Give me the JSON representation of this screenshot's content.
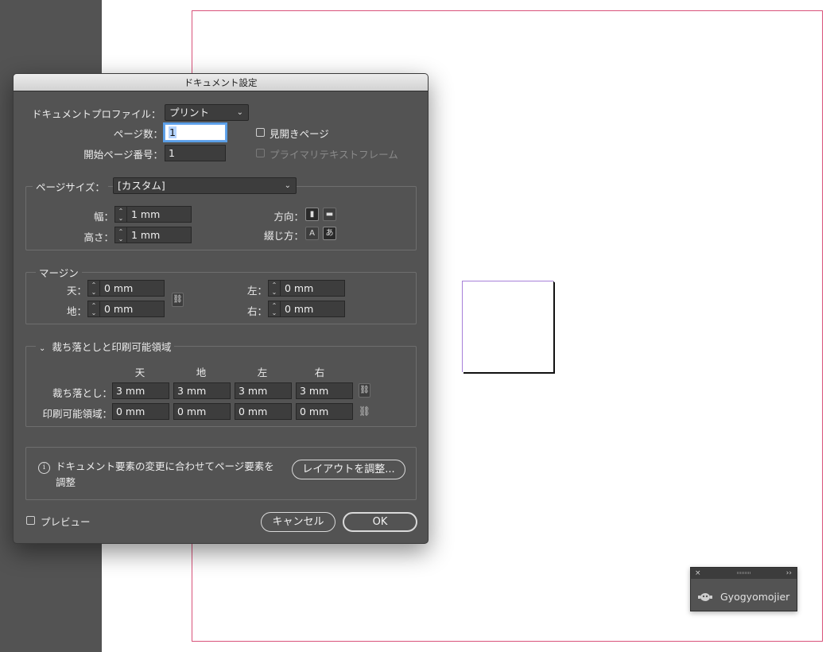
{
  "dialog": {
    "title": "ドキュメント設定",
    "profile_label": "ドキュメントプロファイル：",
    "profile_value": "プリント",
    "pages_label": "ページ数：",
    "pages_value": "1",
    "start_page_label": "開始ページ番号：",
    "start_page_value": "1",
    "facing_pages_label": "見開きページ",
    "facing_pages_checked": false,
    "primary_text_frame_label": "プライマリテキストフレーム",
    "primary_text_frame_enabled": false,
    "page_size": {
      "label": "ページサイズ：",
      "value": "[カスタム]",
      "width_label": "幅：",
      "width_value": "1 mm",
      "height_label": "高さ：",
      "height_value": "1 mm",
      "orientation_label": "方向：",
      "binding_label": "綴じ方："
    },
    "margins": {
      "title": "マージン",
      "top_label": "天：",
      "top_value": "0 mm",
      "bottom_label": "地：",
      "bottom_value": "0 mm",
      "left_label": "左：",
      "left_value": "0 mm",
      "right_label": "右：",
      "right_value": "0 mm"
    },
    "bleed": {
      "title": "裁ち落としと印刷可能領域",
      "col_top": "天",
      "col_bottom": "地",
      "col_left": "左",
      "col_right": "右",
      "bleed_label": "裁ち落とし：",
      "bleed_values": [
        "3 mm",
        "3 mm",
        "3 mm",
        "3 mm"
      ],
      "slug_label": "印刷可能領域：",
      "slug_values": [
        "0 mm",
        "0 mm",
        "0 mm",
        "0 mm"
      ]
    },
    "info": {
      "text_line1": "ドキュメント要素の変更に合わせてページ要素を",
      "text_line2": "調整",
      "adjust_button": "レイアウトを調整..."
    },
    "preview_label": "プレビュー",
    "preview_checked": false,
    "cancel_button": "キャンセル",
    "ok_button": "OK"
  },
  "panel": {
    "close": "×",
    "expand": "››",
    "plugin_name": "Gyogyomojier"
  },
  "colors": {
    "page_border": "#d9527a",
    "dialog_bg": "#535353",
    "pasteboard": "#535353"
  }
}
